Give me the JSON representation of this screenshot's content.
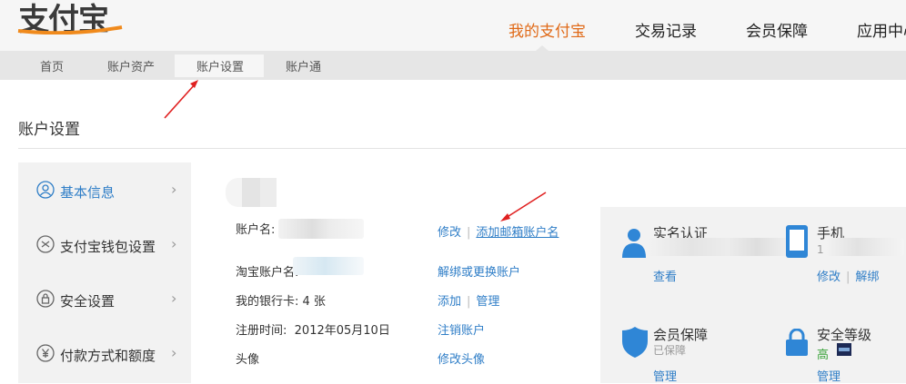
{
  "header": {
    "logo_text": "支付宝",
    "nav": [
      "我的支付宝",
      "交易记录",
      "会员保障",
      "应用中心"
    ],
    "active_nav": "我的支付宝"
  },
  "subnav": {
    "items": [
      "首页",
      "账户资产",
      "账户设置",
      "账户通"
    ],
    "active": "账户设置"
  },
  "page_title": "账户设置",
  "sidebar": {
    "items": [
      {
        "label": "基本信息",
        "icon": "user-icon",
        "active": true
      },
      {
        "label": "支付宝钱包设置",
        "icon": "wallet-icon",
        "active": false
      },
      {
        "label": "安全设置",
        "icon": "lock-icon",
        "active": false
      },
      {
        "label": "付款方式和额度",
        "icon": "yuan-icon",
        "active": false
      }
    ]
  },
  "profile": {
    "account_name_label": "账户名:",
    "taobao_label": "淘宝账户名:",
    "bank_card_label": "我的银行卡: 4 张",
    "register_label": "注册时间:",
    "register_date": "2012年05月10日",
    "avatar_label": "头像"
  },
  "actions": {
    "modify": "修改",
    "add_email": "添加邮箱账户名",
    "unbind_taobao": "解绑或更换账户",
    "add": "添加",
    "manage": "管理",
    "cancel_account": "注销账户",
    "change_avatar": "修改头像"
  },
  "security_panel": {
    "realname": {
      "title": "实名认证",
      "link": "查看"
    },
    "phone": {
      "title": "手机",
      "partial": "1",
      "link_modify": "修改",
      "link_unbind": "解绑"
    },
    "protection": {
      "title": "会员保障",
      "status": "已保障",
      "link": "管理"
    },
    "level": {
      "title": "安全等级",
      "value": "高",
      "link": "管理"
    }
  },
  "colors": {
    "accent_orange": "#e06a18",
    "link_blue": "#2f7ec7",
    "annotation_red": "#e02020"
  }
}
